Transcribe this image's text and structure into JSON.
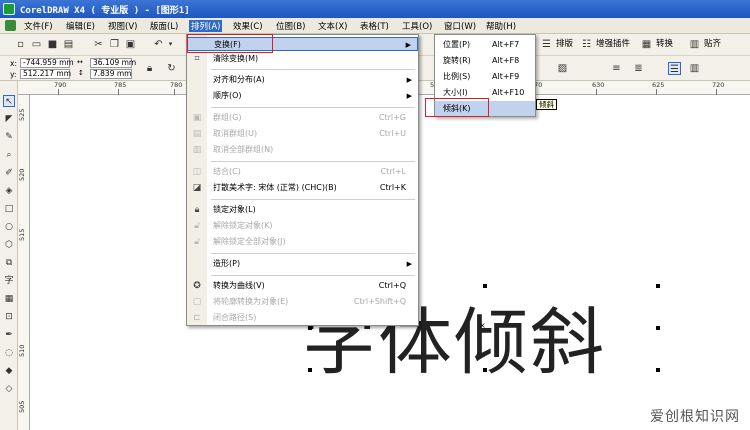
{
  "window": {
    "title": "CorelDRAW X4 ( 专业版 ) - [图形1]"
  },
  "menubar": {
    "items": [
      "文件(F)",
      "编辑(E)",
      "视图(V)",
      "版面(L)",
      "排列(A)",
      "效果(C)",
      "位图(B)",
      "文本(X)",
      "表格(T)",
      "工具(O)",
      "窗口(W)",
      "帮助(H)"
    ],
    "active": "排列(A)"
  },
  "properties": {
    "x_label": "x:",
    "x_value": "-744.959 mm",
    "y_label": "y:",
    "y_value": "512.217 mm",
    "w_value": "36.109 mm",
    "h_value": "7.839 mm"
  },
  "right_toolbar": {
    "typeset": "排版",
    "enhance_plugin": "增强插件",
    "convert": "转换",
    "paste": "贴齐"
  },
  "ruler": {
    "top_ticks": [
      "790",
      "785",
      "780",
      "575",
      "570",
      "630",
      "625",
      "720"
    ],
    "left_ticks": [
      "525",
      "520",
      "515",
      "510",
      "505"
    ]
  },
  "arrange_menu": {
    "transform": "变换(F)",
    "clear_transform": "清除变换(M)",
    "align_distribute": "对齐和分布(A)",
    "order": "顺序(O)",
    "group": "群组(G)",
    "group_shortcut": "Ctrl+G",
    "ungroup": "取消群组(U)",
    "ungroup_shortcut": "Ctrl+U",
    "ungroup_all": "取消全部群组(N)",
    "combine": "结合(C)",
    "combine_shortcut": "Ctrl+L",
    "break_artistic": "打散美术字: 宋体 (正常) (CHC)(B)",
    "break_shortcut": "Ctrl+K",
    "lock": "锁定对象(L)",
    "unlock": "解除锁定对象(K)",
    "unlock_all": "解除锁定全部对象(J)",
    "shaping": "造形(P)",
    "to_curves": "转换为曲线(V)",
    "to_curves_shortcut": "Ctrl+Q",
    "outline_to_object": "将轮廓转换为对象(E)",
    "outline_shortcut": "Ctrl+Shift+Q",
    "close_path": "闭合路径(S)"
  },
  "transform_submenu": {
    "position": "位置(P)",
    "position_shortcut": "Alt+F7",
    "rotate": "旋转(R)",
    "rotate_shortcut": "Alt+F8",
    "scale": "比例(S)",
    "scale_shortcut": "Alt+F9",
    "size": "大小(I)",
    "size_shortcut": "Alt+F10",
    "skew": "倾斜(K)"
  },
  "tooltip": "倾斜",
  "canvas": {
    "artwork_text": "字体倾斜"
  },
  "watermark": "爱创根知识网"
}
